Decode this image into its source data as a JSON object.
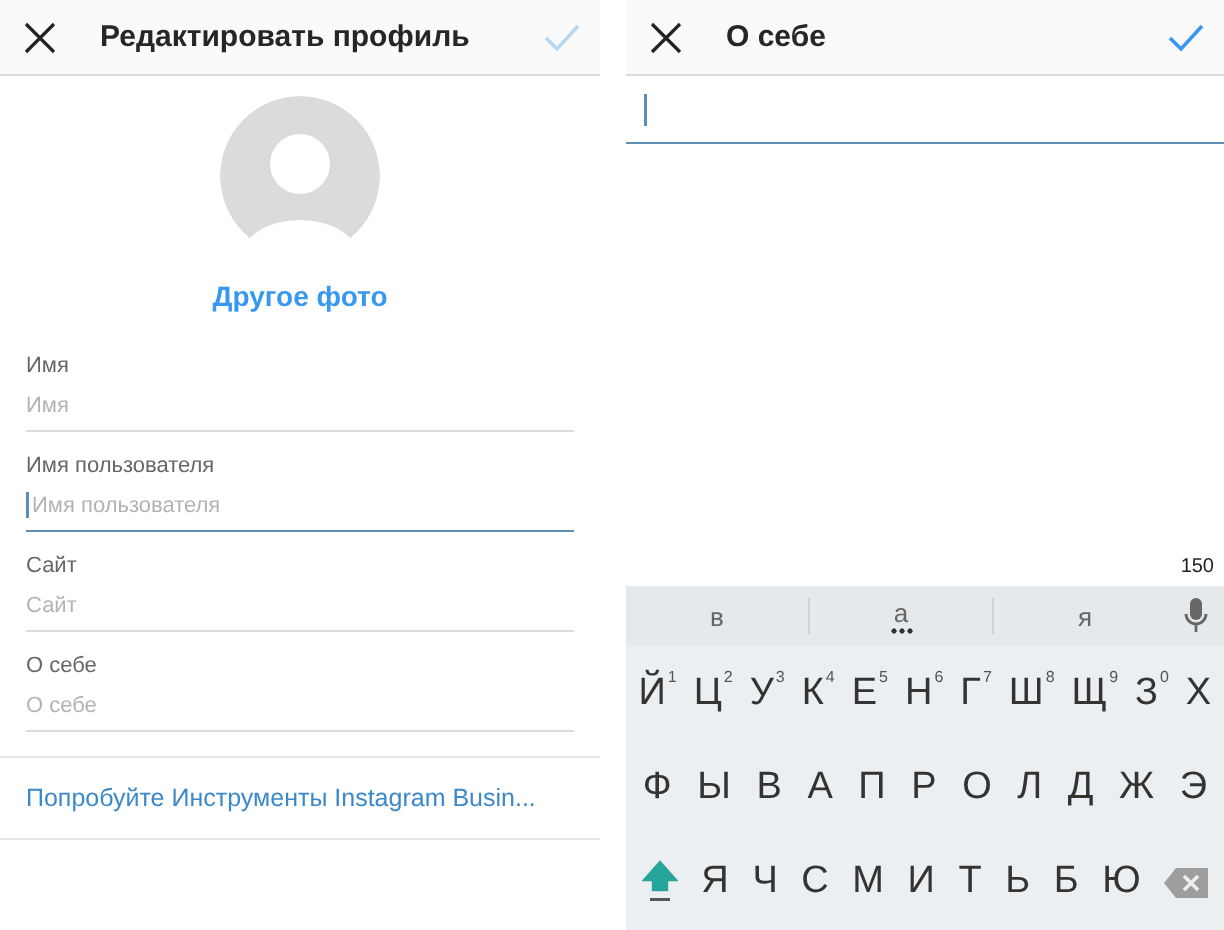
{
  "edit_profile": {
    "header": {
      "title": "Редактировать профиль",
      "confirm_disabled": true
    },
    "change_photo": "Другое фото",
    "fields": [
      {
        "label": "Имя",
        "placeholder": "Имя",
        "focused": false
      },
      {
        "label": "Имя пользователя",
        "placeholder": "Имя пользователя",
        "focused": true
      },
      {
        "label": "Сайт",
        "placeholder": "Сайт",
        "focused": false
      },
      {
        "label": "О себе",
        "placeholder": "О себе",
        "focused": false
      }
    ],
    "business_link": "Попробуйте Инструменты Instagram Busin..."
  },
  "bio": {
    "header": {
      "title": "О себе",
      "confirm_disabled": false
    },
    "field_focused": true,
    "counter": "150",
    "keyboard": {
      "suggestions": [
        {
          "text": "в",
          "more": false
        },
        {
          "text": "а",
          "more": true
        },
        {
          "text": "я",
          "more": false
        }
      ],
      "rows": [
        [
          {
            "kind": "letter",
            "label": "Й",
            "hint": "1"
          },
          {
            "kind": "letter",
            "label": "Ц",
            "hint": "2"
          },
          {
            "kind": "letter",
            "label": "У",
            "hint": "3"
          },
          {
            "kind": "letter",
            "label": "К",
            "hint": "4"
          },
          {
            "kind": "letter",
            "label": "Е",
            "hint": "5"
          },
          {
            "kind": "letter",
            "label": "Н",
            "hint": "6"
          },
          {
            "kind": "letter",
            "label": "Г",
            "hint": "7"
          },
          {
            "kind": "letter",
            "label": "Ш",
            "hint": "8"
          },
          {
            "kind": "letter",
            "label": "Щ",
            "hint": "9"
          },
          {
            "kind": "letter",
            "label": "З",
            "hint": "0"
          },
          {
            "kind": "letter",
            "label": "Х"
          }
        ],
        [
          {
            "kind": "letter",
            "label": "Ф"
          },
          {
            "kind": "letter",
            "label": "Ы"
          },
          {
            "kind": "letter",
            "label": "В"
          },
          {
            "kind": "letter",
            "label": "А"
          },
          {
            "kind": "letter",
            "label": "П"
          },
          {
            "kind": "letter",
            "label": "Р"
          },
          {
            "kind": "letter",
            "label": "О"
          },
          {
            "kind": "letter",
            "label": "Л"
          },
          {
            "kind": "letter",
            "label": "Д"
          },
          {
            "kind": "letter",
            "label": "Ж"
          },
          {
            "kind": "letter",
            "label": "Э"
          }
        ],
        [
          {
            "kind": "shift",
            "on": true
          },
          {
            "kind": "letter",
            "label": "Я"
          },
          {
            "kind": "letter",
            "label": "Ч"
          },
          {
            "kind": "letter",
            "label": "С"
          },
          {
            "kind": "letter",
            "label": "М"
          },
          {
            "kind": "letter",
            "label": "И"
          },
          {
            "kind": "letter",
            "label": "Т"
          },
          {
            "kind": "letter",
            "label": "Ь"
          },
          {
            "kind": "letter",
            "label": "Б"
          },
          {
            "kind": "letter",
            "label": "Ю"
          },
          {
            "kind": "backspace"
          }
        ]
      ]
    }
  }
}
